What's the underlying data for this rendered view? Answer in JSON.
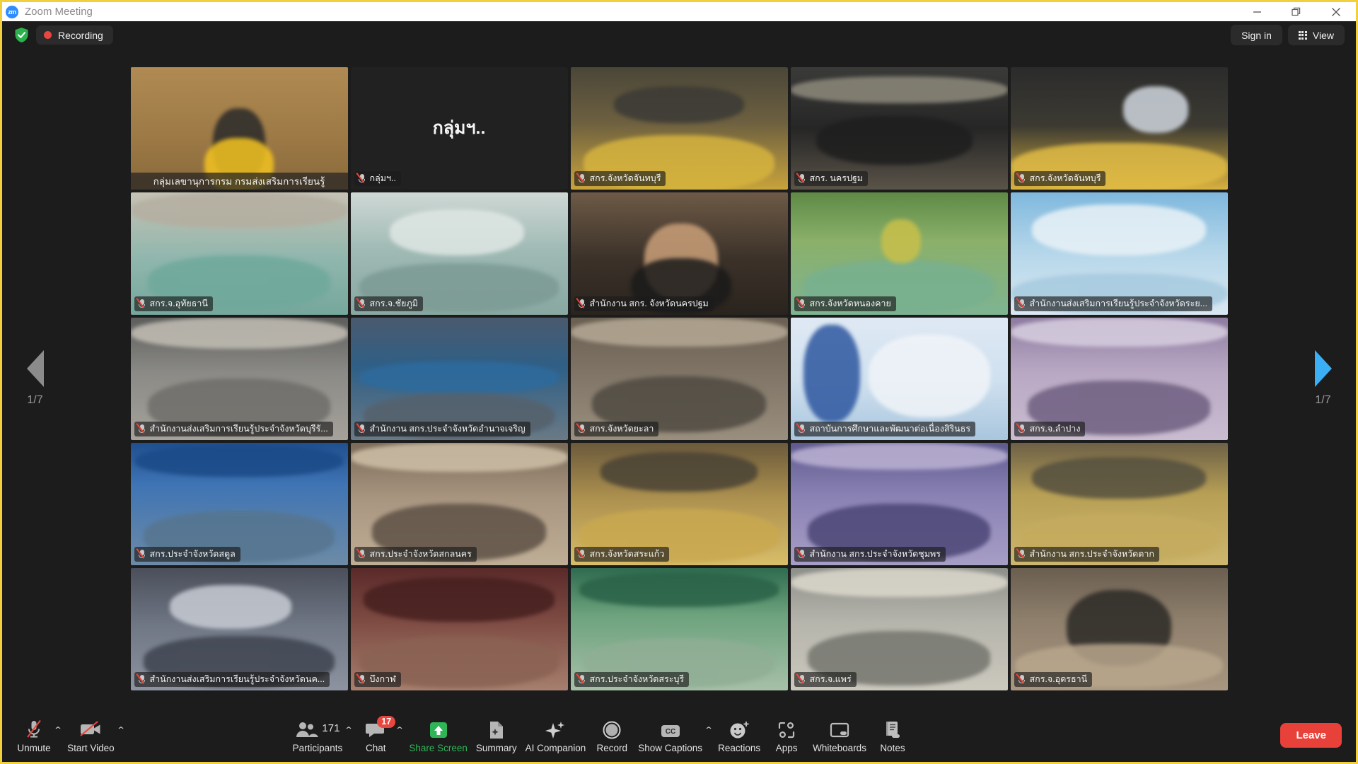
{
  "window": {
    "title": "Zoom Meeting",
    "logo_text": "zm",
    "controls": [
      "minimize",
      "maximize",
      "close"
    ],
    "border_color": "#f2d03b"
  },
  "topbar": {
    "shield_icon": "shield-check-icon",
    "recording_label": "Recording",
    "recording_dot_color": "#e8473f",
    "sign_in_label": "Sign in",
    "view_label": "View"
  },
  "pager": {
    "left_page": "1/7",
    "right_page": "1/7",
    "left_enabled": false,
    "right_enabled": true,
    "left_arrow_color": "#8b8b8b",
    "right_arrow_color": "#3aaff5"
  },
  "gallery": {
    "active_border_color": "#9bdb2e",
    "tiles": [
      {
        "name": "กลุ่มเลขานุการกรม กรมส่งเสริมการเรียนรู้",
        "active": true,
        "muted": false,
        "video": true,
        "scene": "s-podium"
      },
      {
        "name": "กลุ่มฯ..",
        "display": "กลุ่มฯ..",
        "active": false,
        "muted": true,
        "video": false,
        "scene": "s-off"
      },
      {
        "name": "สกร.จังหวัดจันทบุรี",
        "active": false,
        "muted": true,
        "video": true,
        "scene": "s-hall-yellow"
      },
      {
        "name": "สกร. นครปฐม",
        "active": false,
        "muted": true,
        "video": true,
        "scene": "s-hall-dark"
      },
      {
        "name": "สกร.จังหวัดจันทบุรี",
        "active": false,
        "muted": true,
        "video": true,
        "scene": "s-stage-gold"
      },
      {
        "name": "สกร.จ.อุทัยธานี",
        "active": false,
        "muted": true,
        "video": true,
        "scene": "s-room-teal"
      },
      {
        "name": "สกร.จ.ชัยภูมิ",
        "active": false,
        "muted": true,
        "video": true,
        "scene": "s-waterfall"
      },
      {
        "name": "สำนักงาน สกร. จังหวัดนครปฐม",
        "active": false,
        "muted": true,
        "video": true,
        "scene": "s-portrait"
      },
      {
        "name": "สกร.จังหวัดหนองคาย",
        "active": false,
        "muted": true,
        "video": true,
        "scene": "s-room-green"
      },
      {
        "name": "สำนักงานส่งเสริมการเรียนรู้ประจำจังหวัดระย...",
        "active": false,
        "muted": true,
        "video": true,
        "scene": "s-sky-banner"
      },
      {
        "name": "สำนักงานส่งเสริมการเรียนรู้ประจำจังหวัดบุรีรั...",
        "active": false,
        "muted": true,
        "video": true,
        "scene": "s-room-grey"
      },
      {
        "name": "สำนักงาน สกร.ประจำจังหวัดอำนาจเจริญ",
        "active": false,
        "muted": true,
        "video": true,
        "scene": "s-room-blue"
      },
      {
        "name": "สกร.จังหวัดยะลา",
        "active": false,
        "muted": true,
        "video": true,
        "scene": "s-room-wide"
      },
      {
        "name": "สถาบันการศึกษาและพัฒนาต่อเนื่องสิรินธร",
        "active": false,
        "muted": true,
        "video": true,
        "scene": "s-poster"
      },
      {
        "name": "สกร.จ.ลำปาง",
        "active": false,
        "muted": true,
        "video": true,
        "scene": "s-room-purple"
      },
      {
        "name": "สกร.ประจำจังหวัดสตูล",
        "active": false,
        "muted": true,
        "video": true,
        "scene": "s-banner-blue"
      },
      {
        "name": "สกร.ประจำจังหวัดสกลนคร",
        "active": false,
        "muted": true,
        "video": true,
        "scene": "s-room-warm"
      },
      {
        "name": "สกร.จังหวัดสระแก้ว",
        "active": false,
        "muted": true,
        "video": true,
        "scene": "s-hall-gold"
      },
      {
        "name": "สำนักงาน สกร.ประจำจังหวัดชุมพร",
        "active": false,
        "muted": true,
        "video": true,
        "scene": "s-room-violet"
      },
      {
        "name": "สำนักงาน สกร.ประจำจังหวัดตาก",
        "active": false,
        "muted": true,
        "video": true,
        "scene": "s-room-yellow"
      },
      {
        "name": "สำนักงานส่งเสริมการเรียนรู้ประจำจังหวัดนค...",
        "active": false,
        "muted": true,
        "video": true,
        "scene": "s-room-screen"
      },
      {
        "name": "บึงกาฬ",
        "active": false,
        "muted": true,
        "video": true,
        "scene": "s-room-maroon"
      },
      {
        "name": "สกร.ประจำจังหวัดสระบุรี",
        "active": false,
        "muted": true,
        "video": true,
        "scene": "s-banner-green"
      },
      {
        "name": "สกร.จ.แพร่",
        "active": false,
        "muted": true,
        "video": true,
        "scene": "s-room-pale"
      },
      {
        "name": "สกร.จ.อุดรธานี",
        "active": false,
        "muted": true,
        "video": true,
        "scene": "s-room-crowd"
      }
    ]
  },
  "toolbar": {
    "unmute_label": "Unmute",
    "start_video_label": "Start Video",
    "participants_label": "Participants",
    "participants_count": "171",
    "chat_label": "Chat",
    "chat_badge": "17",
    "share_screen_label": "Share Screen",
    "share_screen_color": "#2fb457",
    "summary_label": "Summary",
    "ai_companion_label": "AI Companion",
    "record_label": "Record",
    "show_captions_label": "Show Captions",
    "captions_glyph": "CC",
    "reactions_label": "Reactions",
    "apps_label": "Apps",
    "whiteboards_label": "Whiteboards",
    "notes_label": "Notes",
    "leave_label": "Leave",
    "leave_color": "#e8413a"
  }
}
